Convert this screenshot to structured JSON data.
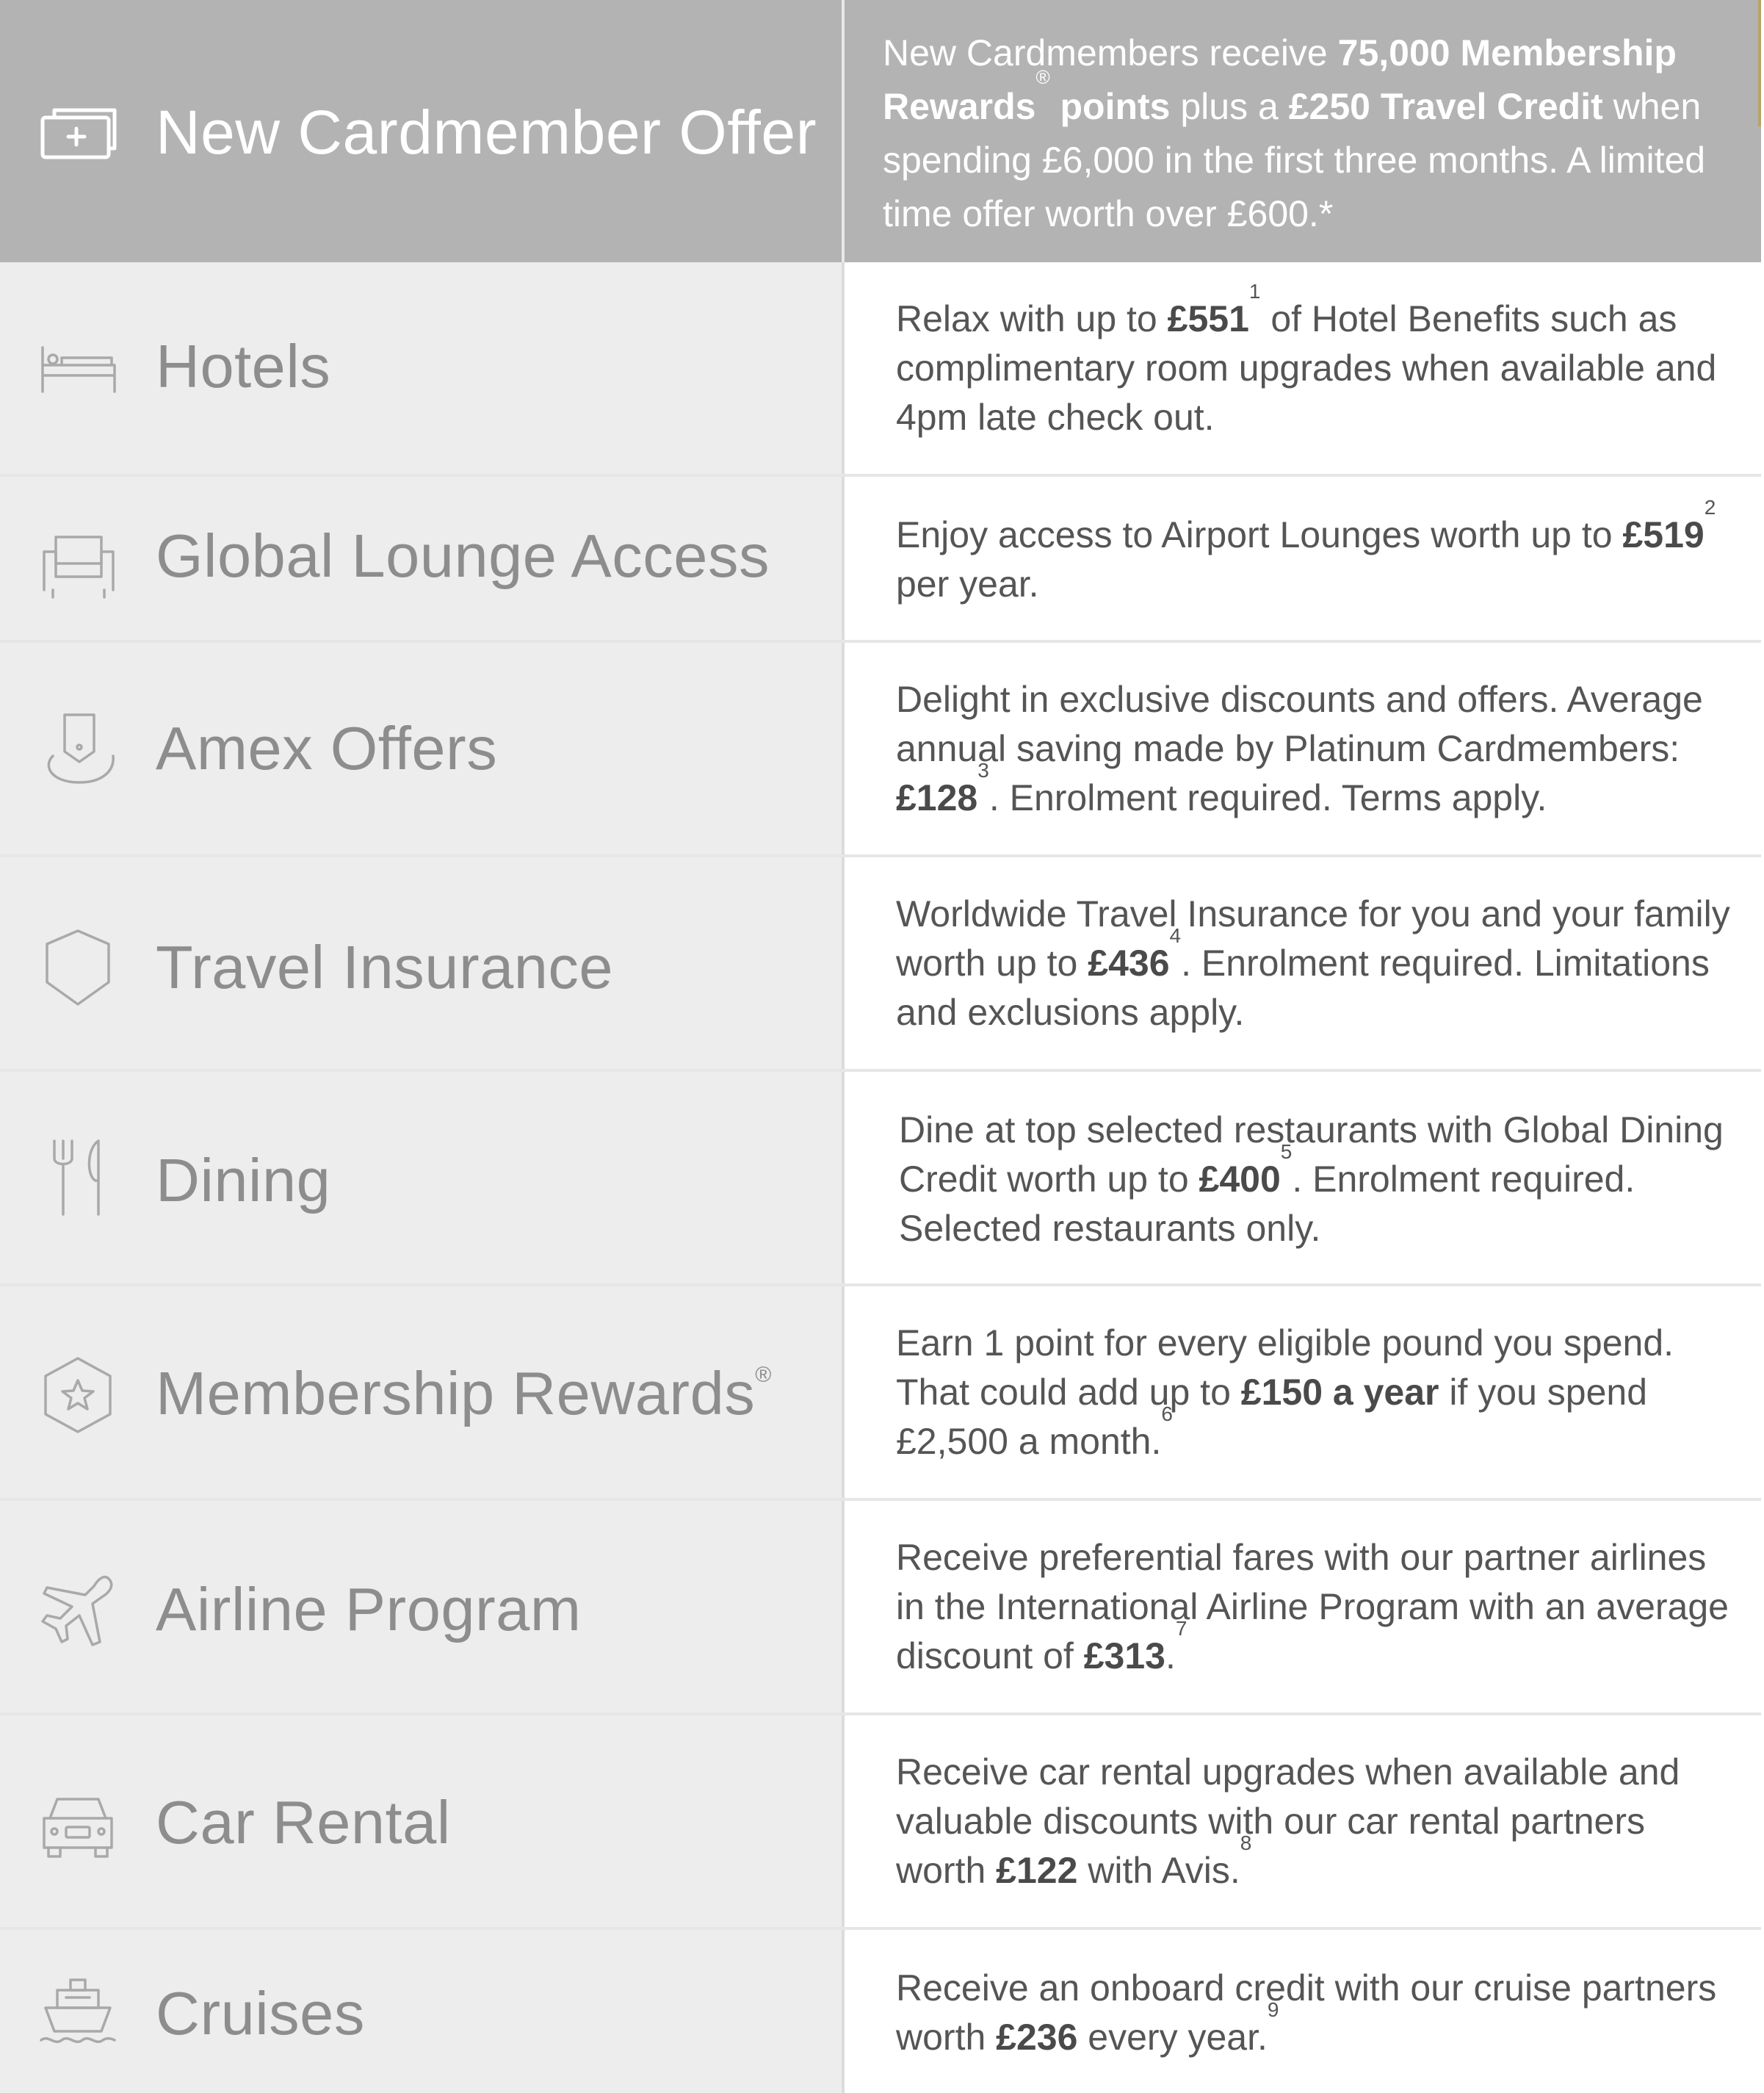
{
  "header": {
    "label": "New Cardmember Offer",
    "icon": "card-plus-icon",
    "desc_1": "New Cardmembers receive ",
    "desc_2": "75,000 Membership Rewards",
    "desc_2_sup": "®",
    "desc_3": " points",
    "desc_4": " plus a ",
    "desc_5": "£250 Travel Credit",
    "desc_6": " when spending £6,000 in the first three months. A limited time offer worth over £600.*"
  },
  "rows": [
    {
      "label": "Hotels",
      "icon": "bed-icon",
      "desc_1": "Relax with up to ",
      "amount": "£551",
      "sup": "1",
      "desc_2": " of Hotel Benefits such as complimentary room upgrades when available and 4pm late check out."
    },
    {
      "label": "Global Lounge Access",
      "icon": "armchair-icon",
      "desc_1": "Enjoy access to Airport Lounges worth up to ",
      "amount": "£519",
      "sup": "2",
      "desc_2": " per year."
    },
    {
      "label": "Amex Offers",
      "icon": "offer-tag-hand-icon",
      "desc_1": "Delight in exclusive discounts and offers. Average annual saving made by Platinum Cardmembers: ",
      "amount": "£128",
      "sup": "3",
      "desc_2": ". Enrolment required. Terms apply."
    },
    {
      "label": "Travel Insurance",
      "icon": "shield-icon",
      "desc_1": "Worldwide Travel Insurance for you and your family worth up to ",
      "amount": "£436",
      "sup": "4",
      "desc_2": ". Enrolment required. Limitations and exclusions apply."
    },
    {
      "label": "Dining",
      "icon": "fork-knife-icon",
      "desc_1": "Dine at top selected restaurants with Global Dining Credit worth up to ",
      "amount": "£400",
      "sup": "5",
      "desc_2": ". Enrolment required. Selected restaurants only."
    },
    {
      "label": "Membership Rewards",
      "label_sup": "®",
      "icon": "star-hexagon-icon",
      "desc_1": "Earn 1 point for every eligible pound you spend.  That could add up to ",
      "amount": "£150 a year",
      "sup": "",
      "desc_2": " if you spend £2,500 a month.",
      "desc_sup": "6"
    },
    {
      "label": "Airline Program",
      "icon": "airplane-icon",
      "desc_1": "Receive preferential fares with our partner airlines in the International Airline Program with an average discount of ",
      "amount": "£313",
      "sup": "",
      "desc_2": ".",
      "desc_sup": "7"
    },
    {
      "label": "Car Rental",
      "icon": "car-icon",
      "desc_1": "Receive car rental upgrades when available and valuable discounts with our car rental partners worth ",
      "amount": "£122",
      "sup": "",
      "desc_2": " with Avis.",
      "desc_sup": "8"
    },
    {
      "label": "Cruises",
      "icon": "cruise-ship-icon",
      "desc_1": "Receive an onboard credit with our cruise partners worth ",
      "amount": "£236",
      "sup": "",
      "desc_2": " every year.",
      "desc_sup": "9"
    }
  ],
  "colors": {
    "header_bg": "#b2b3b2",
    "row_left_bg": "#ededed",
    "label_text": "#8d8d8d",
    "desc_text": "#555555"
  }
}
